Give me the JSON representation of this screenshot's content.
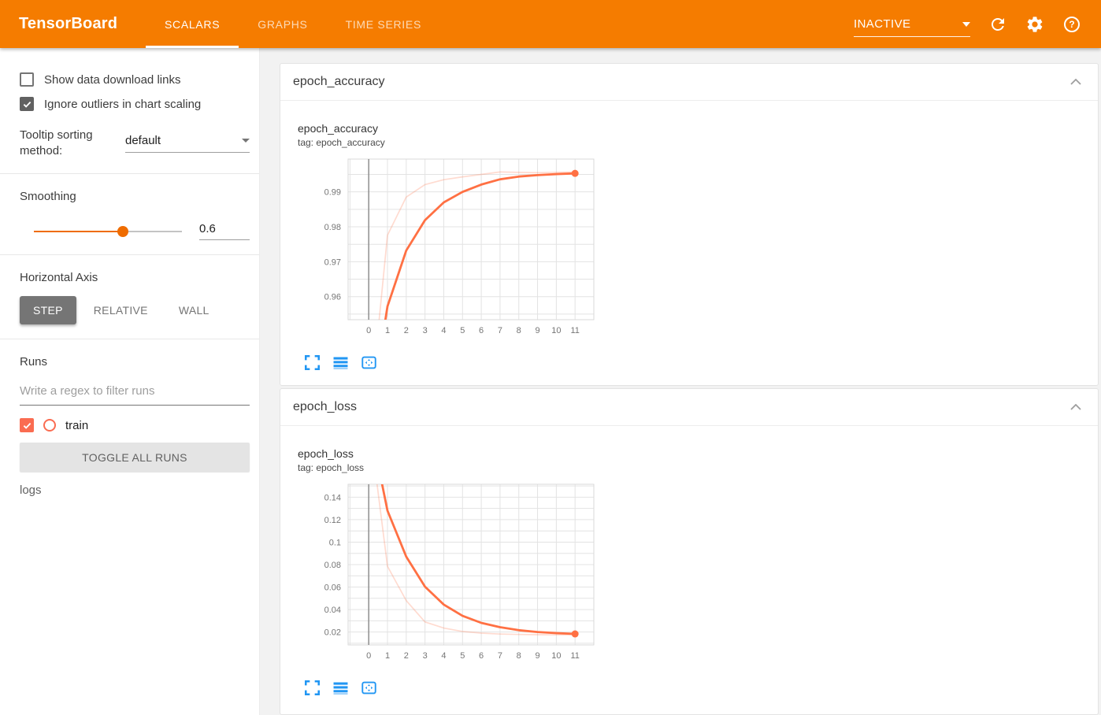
{
  "colors": {
    "header_bg": "#f57c00",
    "accent": "#ef6c00",
    "run": "#ff7043",
    "icon_blue": "#2196f3"
  },
  "header": {
    "title": "TensorBoard",
    "tabs": [
      {
        "label": "SCALARS",
        "active": true
      },
      {
        "label": "GRAPHS",
        "active": false
      },
      {
        "label": "TIME SERIES",
        "active": false
      }
    ],
    "status": "INACTIVE"
  },
  "sidebar": {
    "show_download_links_label": "Show data download links",
    "ignore_outliers_label": "Ignore outliers in chart scaling",
    "tooltip_sorting_label": "Tooltip sorting method:",
    "tooltip_sorting_value": "default",
    "smoothing_label": "Smoothing",
    "smoothing_value": "0.6",
    "horizontal_axis_label": "Horizontal Axis",
    "axis_options": [
      "STEP",
      "RELATIVE",
      "WALL"
    ],
    "runs_label": "Runs",
    "runs_filter_placeholder": "Write a regex to filter runs",
    "run_name": "train",
    "toggle_all_label": "TOGGLE ALL RUNS",
    "logs_label": "logs"
  },
  "cards": [
    {
      "header": "epoch_accuracy"
    },
    {
      "header": "epoch_loss"
    }
  ],
  "chart_data": [
    {
      "type": "line",
      "title": "epoch_accuracy",
      "subtitle": "tag: epoch_accuracy",
      "x": [
        0,
        1,
        2,
        3,
        4,
        5,
        6,
        7,
        8,
        9,
        10,
        11
      ],
      "series": [
        {
          "name": "train",
          "style": "raw",
          "values": [
            0.923,
            0.9776,
            0.9885,
            0.9921,
            0.9935,
            0.9943,
            0.995,
            0.9957,
            0.9956,
            0.9955,
            0.9956,
            0.9957
          ]
        },
        {
          "name": "train (smoothed 0.6)",
          "style": "smoothed",
          "values": [
            0.923,
            0.9572,
            0.9732,
            0.9819,
            0.987,
            0.99,
            0.9921,
            0.9936,
            0.9944,
            0.9948,
            0.9951,
            0.9953
          ]
        }
      ],
      "xlim": [
        -1.1,
        12.0
      ],
      "ylim": [
        0.9534,
        0.9994
      ],
      "y_grid_step": 0.005,
      "yticks": [
        {
          "value": 0.96,
          "label": "0.96"
        },
        {
          "value": 0.97,
          "label": "0.97"
        },
        {
          "value": 0.98,
          "label": "0.98"
        },
        {
          "value": 0.99,
          "label": "0.99"
        }
      ],
      "xticks": [
        0,
        1,
        2,
        3,
        4,
        5,
        6,
        7,
        8,
        9,
        10,
        11
      ],
      "end_marker": {
        "x": 11,
        "y": 0.9953
      },
      "grid": true,
      "legend_position": "none"
    },
    {
      "type": "line",
      "title": "epoch_loss",
      "subtitle": "tag: epoch_loss",
      "x": [
        0,
        1,
        2,
        3,
        4,
        5,
        6,
        7,
        8,
        9,
        10,
        11
      ],
      "series": [
        {
          "name": "train",
          "style": "raw",
          "values": [
            0.21,
            0.0785,
            0.048,
            0.029,
            0.0235,
            0.0205,
            0.019,
            0.0182,
            0.0178,
            0.0176,
            0.0175,
            0.0174
          ]
        },
        {
          "name": "train (smoothed 0.6)",
          "style": "smoothed",
          "values": [
            0.21,
            0.128,
            0.0871,
            0.0604,
            0.0444,
            0.0344,
            0.0281,
            0.0243,
            0.0216,
            0.02,
            0.019,
            0.0183
          ]
        }
      ],
      "xlim": [
        -1.1,
        12.0
      ],
      "ylim": [
        0.0085,
        0.1515
      ],
      "y_grid_step": 0.01,
      "yticks": [
        {
          "value": 0.02,
          "label": "0.02"
        },
        {
          "value": 0.04,
          "label": "0.04"
        },
        {
          "value": 0.06,
          "label": "0.06"
        },
        {
          "value": 0.08,
          "label": "0.08"
        },
        {
          "value": 0.1,
          "label": "0.1"
        },
        {
          "value": 0.12,
          "label": "0.12"
        },
        {
          "value": 0.14,
          "label": "0.14"
        }
      ],
      "xticks": [
        0,
        1,
        2,
        3,
        4,
        5,
        6,
        7,
        8,
        9,
        10,
        11
      ],
      "end_marker": {
        "x": 11,
        "y": 0.0183
      },
      "grid": true,
      "legend_position": "none"
    }
  ]
}
